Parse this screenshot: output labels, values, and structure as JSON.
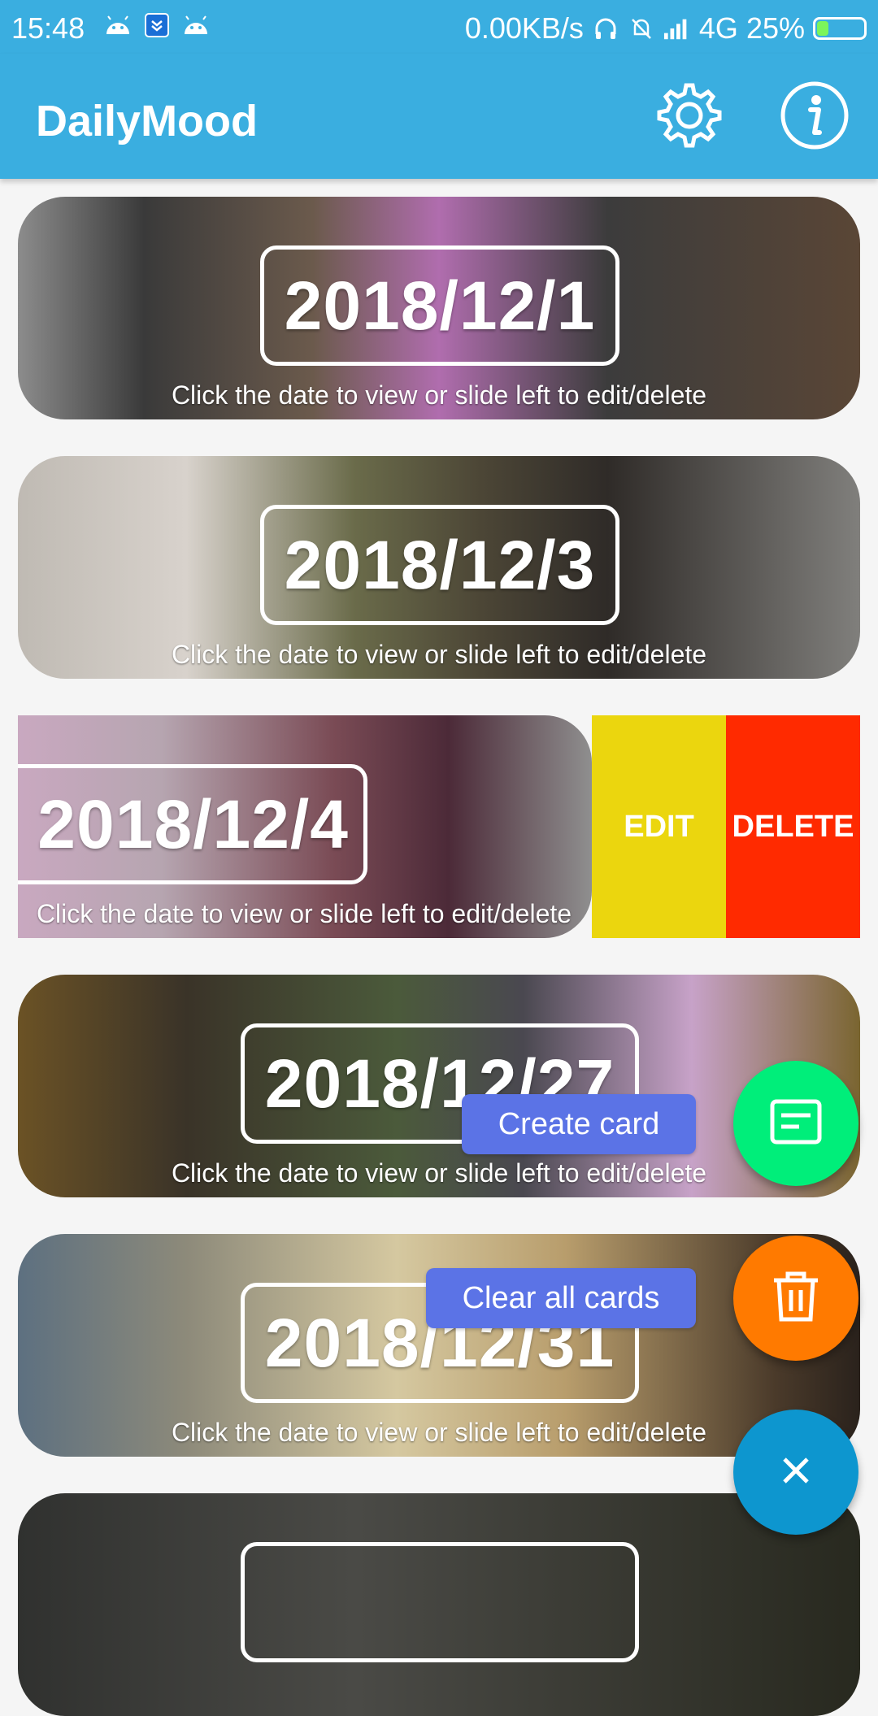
{
  "status_bar": {
    "time": "15:48",
    "speed": "0.00KB/s",
    "network": "4G",
    "battery": "25%",
    "battery_level": 0.25,
    "icons": [
      "android-icon",
      "download-icon",
      "android-icon",
      "headphones-icon",
      "bell-muted-icon",
      "signal-icon"
    ]
  },
  "app_bar": {
    "title": "DailyMood",
    "settings_icon": "gear-icon",
    "info_icon": "info-icon"
  },
  "cards": [
    {
      "date": "2018/12/1",
      "hint": "Click the date to view or slide left to edit/delete"
    },
    {
      "date": "2018/12/3",
      "hint": "Click the date to view or slide left to edit/delete"
    },
    {
      "date": "2018/12/4",
      "hint": "Click the date to view or slide left to edit/delete"
    },
    {
      "date": "2018/12/27",
      "hint": "Click the date to view or slide left to edit/delete"
    },
    {
      "date": "2018/12/31",
      "hint": "Click the date to view or slide left to edit/delete"
    }
  ],
  "swipe_actions": {
    "edit": "EDIT",
    "delete": "DELETE"
  },
  "fab_menu": {
    "create_label": "Create card",
    "clear_label": "Clear all cards",
    "create_icon": "card-icon",
    "clear_icon": "trash-icon",
    "close_icon": "close-icon"
  },
  "colors": {
    "primary": "#3aaee0",
    "edit": "#ebd60e",
    "delete": "#ff2a00",
    "fab_create": "#00ee7a",
    "fab_clear": "#ff7a00",
    "fab_close": "#0d96cf",
    "fab_label": "#5b73e6"
  }
}
